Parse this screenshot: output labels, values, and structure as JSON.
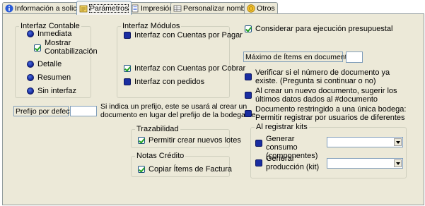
{
  "tabs": [
    {
      "label": "Información a solicitar",
      "icon": "info-icon"
    },
    {
      "label": "Parámetros",
      "icon": "parameters-icon"
    },
    {
      "label": "Impresión",
      "icon": "document-icon"
    },
    {
      "label": "Personalizar nombres",
      "icon": "table-icon"
    },
    {
      "label": "Otros",
      "icon": "coin-icon"
    }
  ],
  "interfaz_contable": {
    "title": "Interfaz Contable",
    "inmediata": "Inmediata",
    "mostrar": "Mostrar Contabilización",
    "detalle": "Detalle",
    "resumen": "Resumen",
    "sin_interfaz": "Sin  interfaz"
  },
  "interfaz_modulos": {
    "title": "Interfaz Módulos",
    "cxp": "Interfaz con Cuentas por Pagar",
    "cxc": "Interfaz con Cuentas por Cobrar",
    "pedidos": "Interfaz con pedidos"
  },
  "prefijo": {
    "label": "Prefijo por defecto",
    "note_line1": "Si indica un prefijo, este se usará al crear un",
    "note_line2": "documento en lugar del prefijo de la bodega de"
  },
  "trazabilidad": {
    "title": "Trazabilidad",
    "lotes": "Permitir crear nuevos lotes"
  },
  "notas_credito": {
    "title": "Notas Crédito",
    "copiar": "Copiar Ítems de Factura"
  },
  "right": {
    "considerar": "Considerar para ejecución presupuestal",
    "maximo_label": "Máximo de Ítems en documento",
    "verificar": "Verificar si el número de documento ya existe. (Pregunta si continuar o no)",
    "sugerir": "Al crear un nuevo documento, sugerir los últimos datos dados al #documento",
    "restringido": "Documento restringido a una única bodega: Permitir registrar por usuarios de diferentes bodegas"
  },
  "kits": {
    "title": "Al registrar kits",
    "consumo": "Generar consumo (componentes)",
    "produccion": "Generar producción (kit)"
  }
}
